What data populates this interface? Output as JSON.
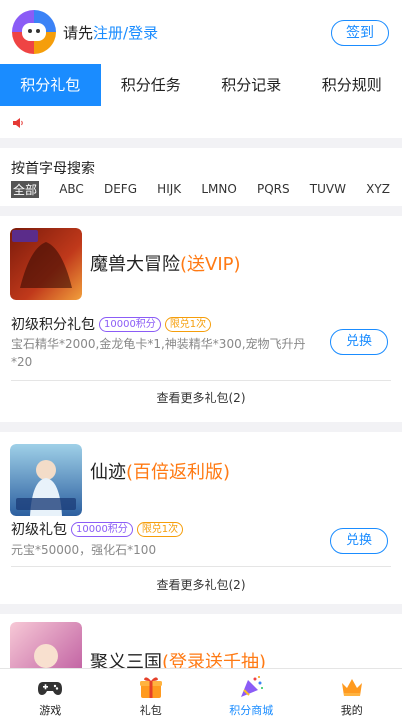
{
  "header": {
    "login_prefix": "请先",
    "login_link": "注册/登录",
    "signin_label": "签到"
  },
  "tabs": [
    {
      "label": "积分礼包",
      "active": true
    },
    {
      "label": "积分任务",
      "active": false
    },
    {
      "label": "积分记录",
      "active": false
    },
    {
      "label": "积分规则",
      "active": false
    }
  ],
  "alpha_search": {
    "title": "按首字母搜索",
    "letters": [
      "全部",
      "ABC",
      "DEFG",
      "HIJK",
      "LMNO",
      "PQRS",
      "TUVW",
      "XYZ"
    ]
  },
  "games": [
    {
      "name": "魔兽大冒险",
      "tag": "(送VIP)",
      "pack_title": "初级积分礼包",
      "points_badge": "10000积分",
      "limit_badge": "限兑1次",
      "desc": "宝石精华*2000,金龙龟卡*1,神装精华*300,宠物飞升丹*20",
      "exchange_label": "兑换",
      "more_label": "查看更多礼包(2)"
    },
    {
      "name": "仙迹",
      "tag": "(百倍返利版)",
      "pack_title": "初级礼包",
      "points_badge": "10000积分",
      "limit_badge": "限兑1次",
      "desc": "元宝*50000，强化石*100",
      "exchange_label": "兑换",
      "more_label": "查看更多礼包(2)"
    },
    {
      "name": "聚义三国",
      "tag": "(登录送千抽)"
    }
  ],
  "bottom_nav": [
    {
      "label": "游戏",
      "icon": "gamepad-icon"
    },
    {
      "label": "礼包",
      "icon": "gift-icon"
    },
    {
      "label": "积分商城",
      "icon": "party-popper-icon",
      "active": true
    },
    {
      "label": "我的",
      "icon": "crown-icon"
    }
  ],
  "colors": {
    "accent": "#1a8cff",
    "tag_orange": "#ff7a14",
    "points_purple": "#8b5cf6",
    "limit_amber": "#f59e0b"
  }
}
